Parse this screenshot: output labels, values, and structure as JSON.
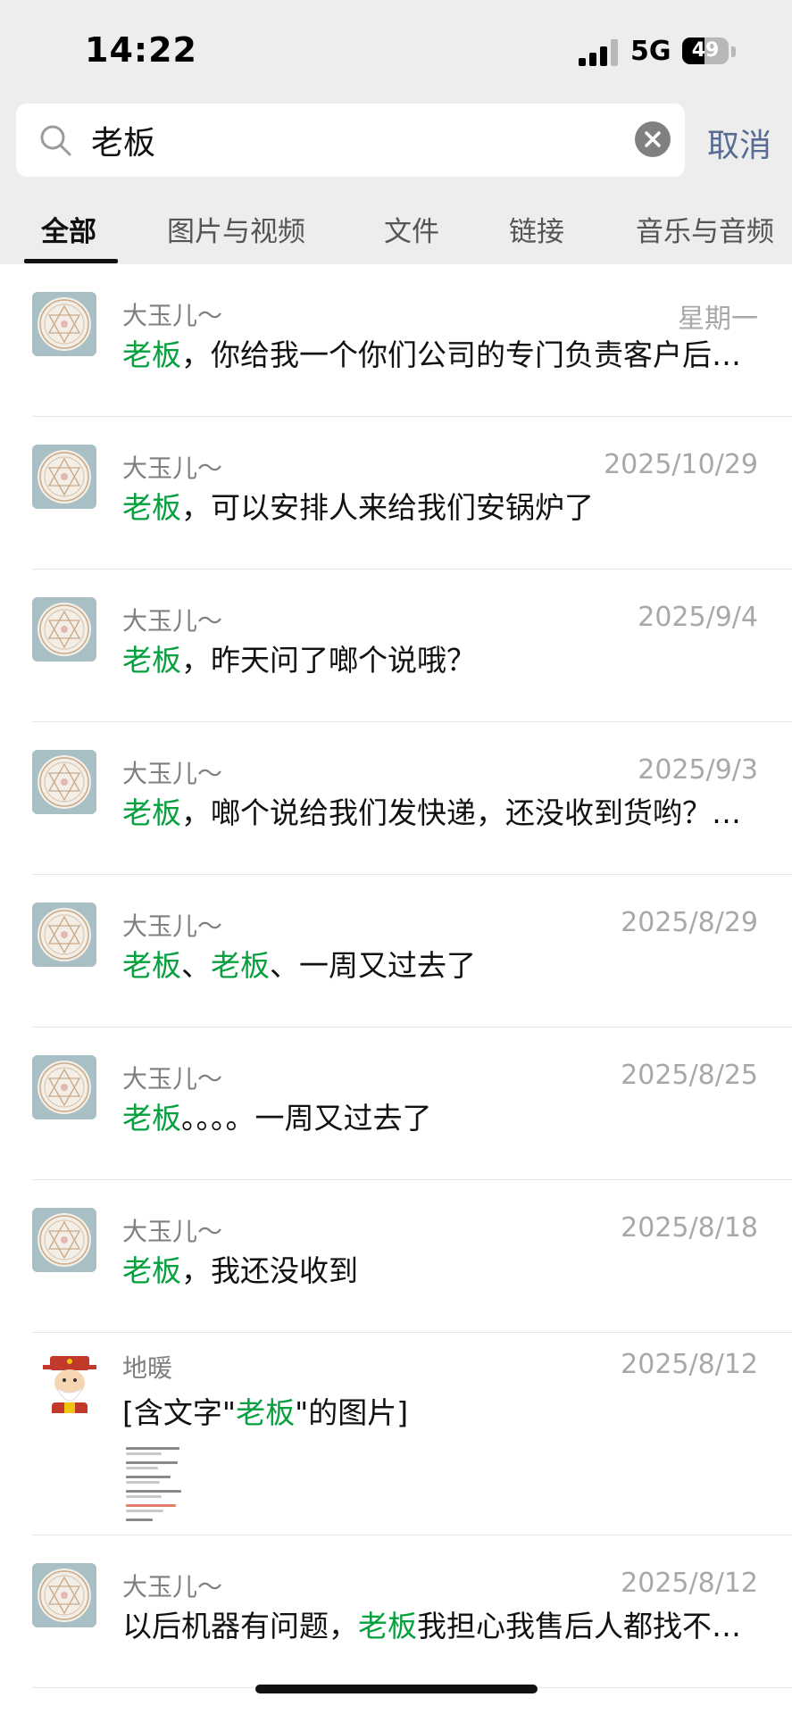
{
  "status_bar": {
    "time": "14:22",
    "network": "5G",
    "battery": "49",
    "battery_level": 0.49
  },
  "search": {
    "query": "老板",
    "cancel_label": "取消"
  },
  "tabs": [
    {
      "label": "全部",
      "active": true
    },
    {
      "label": "图片与视频",
      "active": false
    },
    {
      "label": "文件",
      "active": false
    },
    {
      "label": "链接",
      "active": false
    },
    {
      "label": "音乐与音频",
      "active": false
    }
  ],
  "results": [
    {
      "name": "大玉儿～",
      "date": "星期一",
      "avatar": "seal-avatar",
      "message": [
        {
          "t": "老板",
          "hl": true
        },
        {
          "t": "，你给我一个你们公司的专门负责客户后…",
          "hl": false
        }
      ]
    },
    {
      "name": "大玉儿～",
      "date": "2025/10/29",
      "avatar": "seal-avatar",
      "message": [
        {
          "t": "老板",
          "hl": true
        },
        {
          "t": "，可以安排人来给我们安锅炉了",
          "hl": false
        }
      ]
    },
    {
      "name": "大玉儿～",
      "date": "2025/9/4",
      "avatar": "seal-avatar",
      "message": [
        {
          "t": "老板",
          "hl": true
        },
        {
          "t": "，昨天问了啷个说哦？",
          "hl": false
        }
      ]
    },
    {
      "name": "大玉儿～",
      "date": "2025/9/3",
      "avatar": "seal-avatar",
      "message": [
        {
          "t": "老板",
          "hl": true
        },
        {
          "t": "，啷个说给我们发快递，还没收到货哟？…",
          "hl": false
        }
      ]
    },
    {
      "name": "大玉儿～",
      "date": "2025/8/29",
      "avatar": "seal-avatar",
      "message": [
        {
          "t": "老板",
          "hl": true
        },
        {
          "t": "、",
          "hl": false
        },
        {
          "t": "老板",
          "hl": true
        },
        {
          "t": "、一周又过去了",
          "hl": false
        }
      ]
    },
    {
      "name": "大玉儿～",
      "date": "2025/8/25",
      "avatar": "seal-avatar",
      "message": [
        {
          "t": "老板",
          "hl": true
        },
        {
          "t": "。。。。一周又过去了",
          "hl": false
        }
      ]
    },
    {
      "name": "大玉儿～",
      "date": "2025/8/18",
      "avatar": "seal-avatar",
      "message": [
        {
          "t": "老板",
          "hl": true
        },
        {
          "t": "，我还没收到",
          "hl": false
        }
      ]
    },
    {
      "name": "地暖",
      "date": "2025/8/12",
      "avatar": "god-of-wealth-avatar",
      "has_thumbnail": true,
      "message": [
        {
          "t": "[含文字\"",
          "hl": false
        },
        {
          "t": "老板",
          "hl": true
        },
        {
          "t": "\"的图片]",
          "hl": false
        }
      ]
    },
    {
      "name": "大玉儿～",
      "date": "2025/8/12",
      "avatar": "seal-avatar",
      "message": [
        {
          "t": "以后机器有问题，",
          "hl": false
        },
        {
          "t": "老板",
          "hl": true
        },
        {
          "t": "我担心我售后人都找不…",
          "hl": false
        }
      ]
    }
  ],
  "colors": {
    "highlight": "#07a03f",
    "link_blue": "#576b95",
    "top_bg": "#ededed"
  }
}
